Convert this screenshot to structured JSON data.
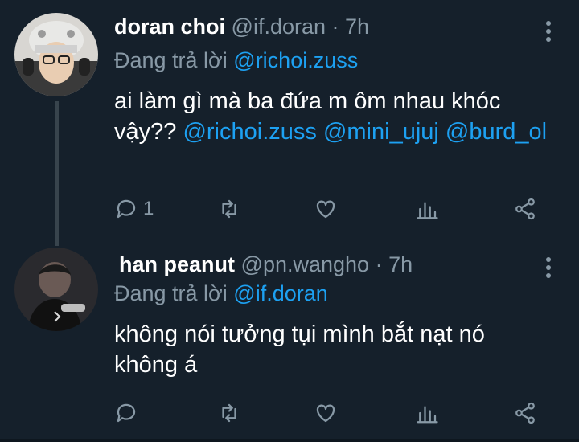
{
  "tweets": [
    {
      "name": "doran choi",
      "handle": "@if.doran",
      "dot": "·",
      "time": "7h",
      "reply_prefix": "Đang trả lời",
      "reply_to": "@richoi.zuss",
      "text_plain": "ai làm gì mà ba đứa m ôm nhau khóc vậy??",
      "mentions": [
        "@richoi.zuss",
        "@mini_ujuj",
        "@burd_ol"
      ],
      "reply_count": "1",
      "icons": [
        "comment-icon",
        "retweet-icon",
        "like-icon",
        "analytics-icon",
        "share-icon",
        "more-icon"
      ]
    },
    {
      "name": "han peanut",
      "handle": "@pn.wangho",
      "dot": "·",
      "time": "7h",
      "reply_prefix": "Đang trả lời",
      "reply_to": "@if.doran",
      "text_plain": "không nói tưởng tụi mình bắt nạt nó không á",
      "icons": [
        "comment-icon",
        "retweet-icon",
        "like-icon",
        "analytics-icon",
        "share-icon",
        "more-icon"
      ]
    }
  ],
  "colors": {
    "background": "#15202b",
    "mention": "#1da1f2",
    "muted": "#8899a6",
    "thread_line": "#38444d"
  }
}
